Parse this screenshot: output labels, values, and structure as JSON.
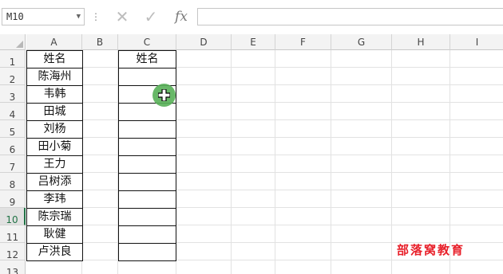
{
  "formula_bar": {
    "name_box": "M10",
    "name_box_arrow": "▼",
    "separator": "⋮",
    "cancel_glyph": "✕",
    "confirm_glyph": "✓",
    "fx_label": "fx",
    "formula_value": ""
  },
  "columns": [
    "A",
    "B",
    "C",
    "D",
    "E",
    "F",
    "G",
    "H",
    "I"
  ],
  "rows": [
    "1",
    "2",
    "3",
    "4",
    "5",
    "6",
    "7",
    "8",
    "9",
    "10",
    "11",
    "12",
    "13"
  ],
  "active_row": "10",
  "column_a": [
    "姓名",
    "陈海州",
    "韦韩",
    "田城",
    "刘杨",
    "田小菊",
    "王力",
    "吕树添",
    "李玮",
    "陈宗瑞",
    "耿健",
    "卢洪良"
  ],
  "column_c": [
    "姓名",
    "",
    "",
    "",
    "",
    "",
    "",
    "",
    "",
    "",
    "",
    ""
  ],
  "watermark": "部落窝教育",
  "colors": {
    "cursor": "#58b058",
    "active_header": "#217346",
    "watermark": "#e8202a"
  }
}
